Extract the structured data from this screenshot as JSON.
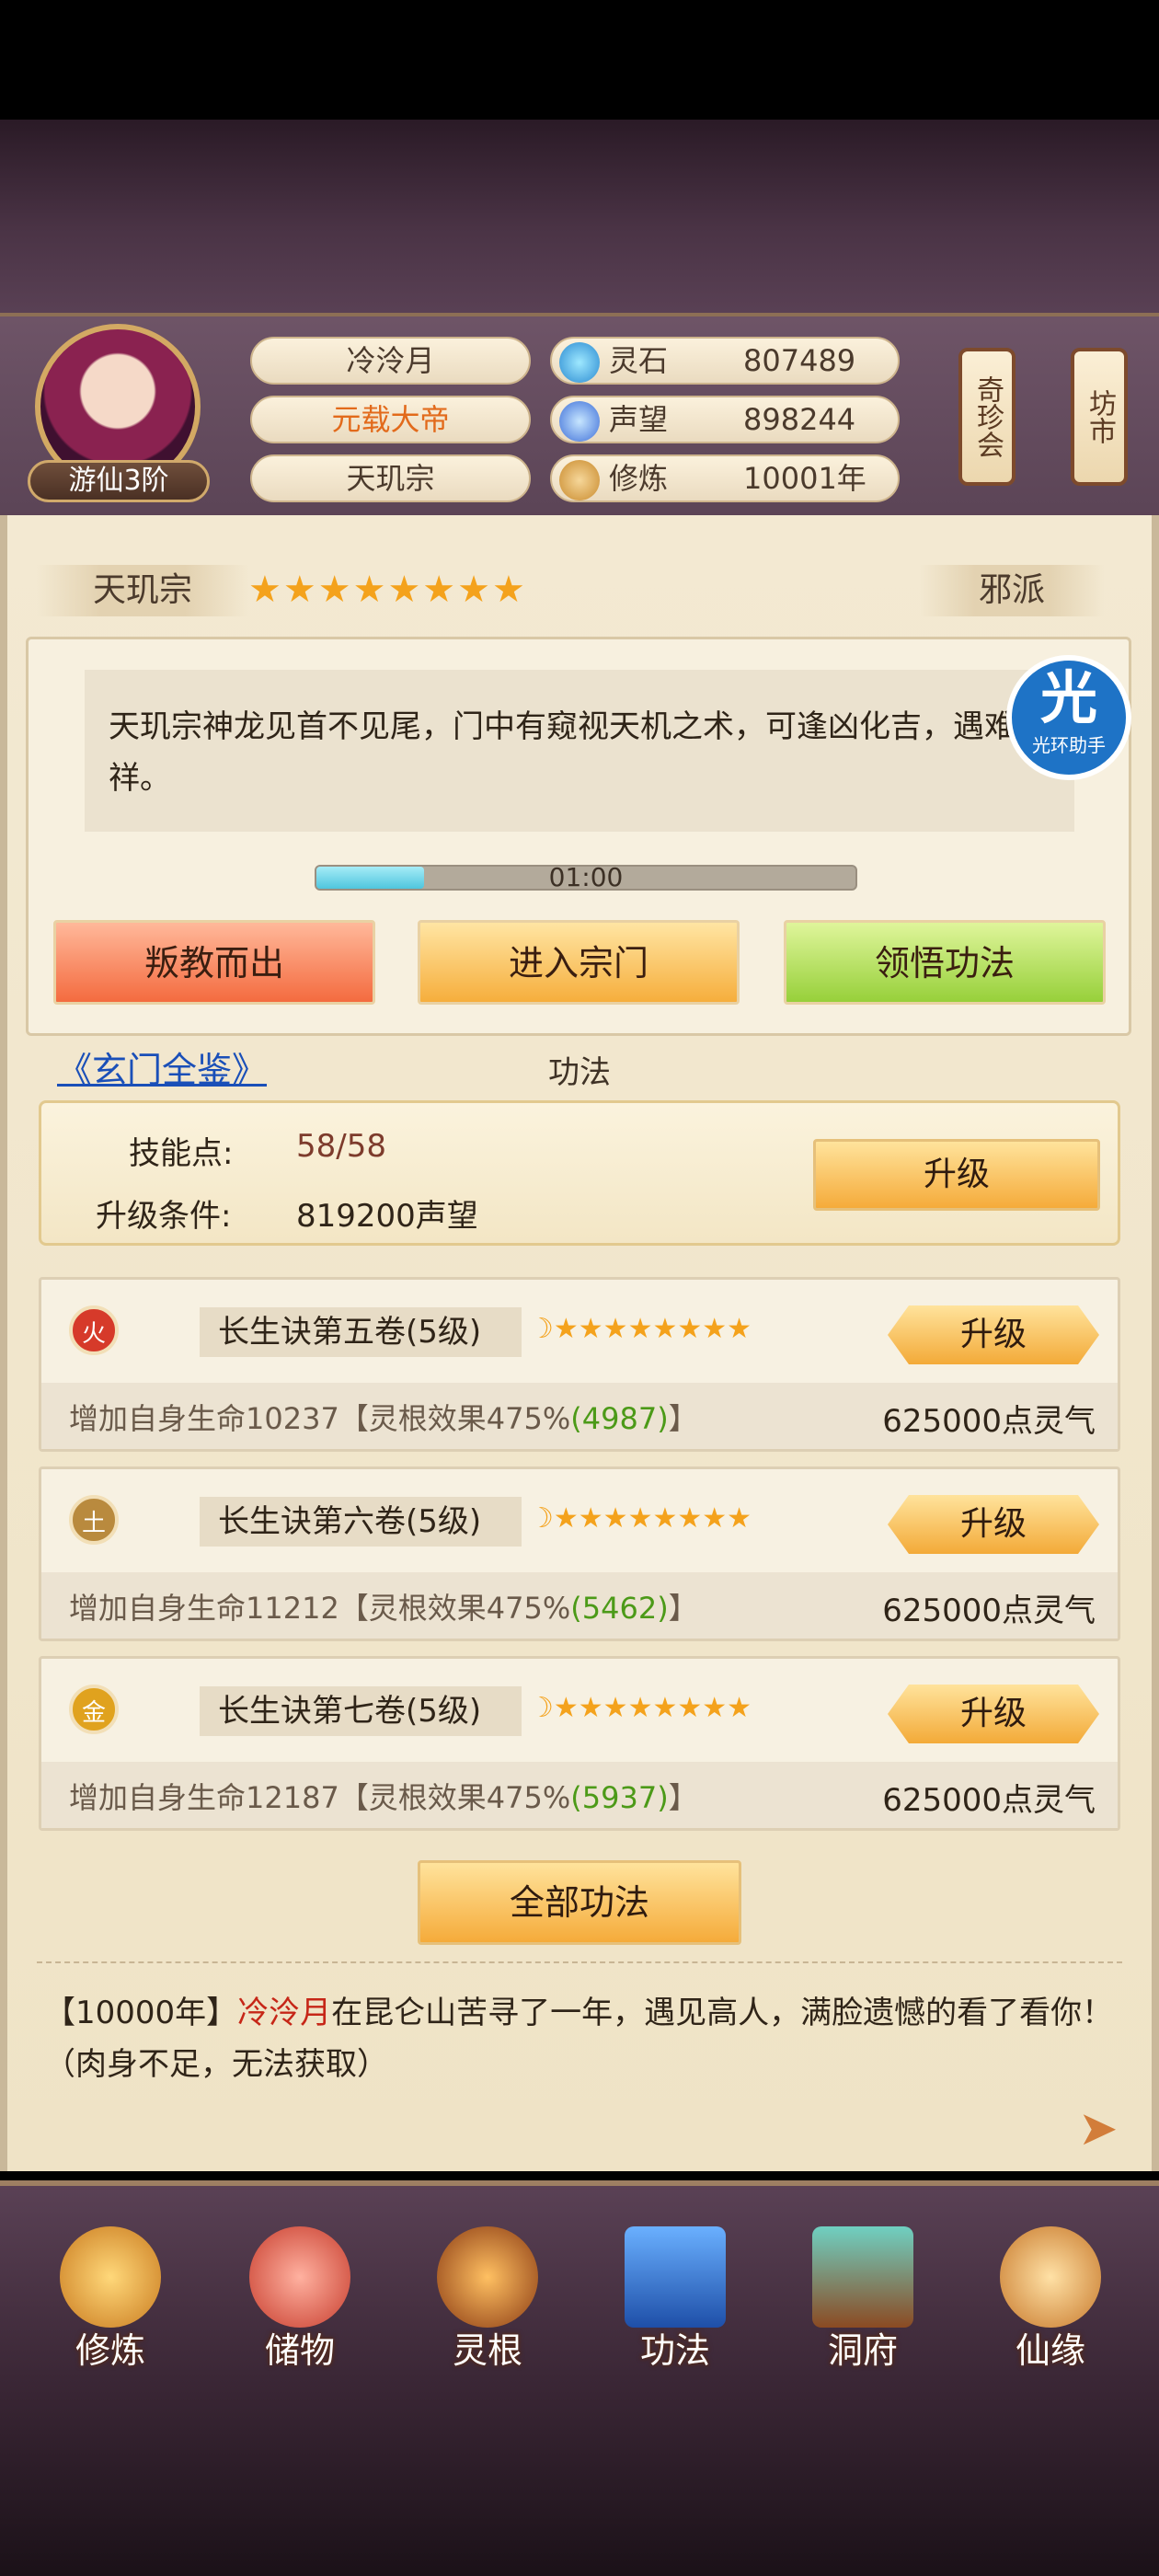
{
  "header": {
    "rank": "游仙3阶",
    "name": "冷泠月",
    "title": "元载大帝",
    "sect": "天玑宗",
    "resources": [
      {
        "label": "灵石",
        "value": "807489",
        "icon": "spirit-stone-icon"
      },
      {
        "label": "声望",
        "value": "898244",
        "icon": "prestige-icon"
      },
      {
        "label": "修炼",
        "value": "10001年",
        "icon": "meditation-icon"
      }
    ],
    "side_buttons": [
      "奇珍会",
      "坊市"
    ]
  },
  "sect_panel": {
    "name": "天玑宗",
    "stars": "★★★★★★★★",
    "faction": "邪派",
    "description": "天玑宗神龙见首不见尾，门中有窥视天机之术，可逢凶化吉，遇难呈祥。",
    "timer": "01:00",
    "timer_progress": 0.2,
    "buttons": [
      "叛教而出",
      "进入宗门",
      "领悟功法"
    ],
    "halo_badge": {
      "big": "光",
      "small": "光环助手"
    }
  },
  "gongfa": {
    "link": "《玄门全鉴》",
    "title": "功法",
    "skill_points_label": "技能点:",
    "skill_points_value": "58/58",
    "upgrade_cond_label": "升级条件:",
    "upgrade_cond_value": "819200声望",
    "upgrade_button": "升级",
    "techniques": [
      {
        "element": "火",
        "element_color": "#d63a2a",
        "name": "长生诀第五卷(5级)",
        "stars": "☽★★★★★★★★",
        "button": "升级",
        "effect_prefix": "增加自身生命10237【灵根效果475%",
        "effect_bonus": "(4987)",
        "effect_suffix": "】",
        "cost": "625000点灵气"
      },
      {
        "element": "土",
        "element_color": "#b98a3e",
        "name": "长生诀第六卷(5级)",
        "stars": "☽★★★★★★★★",
        "button": "升级",
        "effect_prefix": "增加自身生命11212【灵根效果475%",
        "effect_bonus": "(5462)",
        "effect_suffix": "】",
        "cost": "625000点灵气"
      },
      {
        "element": "金",
        "element_color": "#e0a21e",
        "name": "长生诀第七卷(5级)",
        "stars": "☽★★★★★★★★",
        "button": "升级",
        "effect_prefix": "增加自身生命12187【灵根效果475%",
        "effect_bonus": "(5937)",
        "effect_suffix": "】",
        "cost": "625000点灵气"
      }
    ],
    "all_button": "全部功法"
  },
  "log": {
    "year": "【10000年】",
    "name": "冷泠月",
    "text": "在昆仑山苦寻了一年，遇见高人，满脸遗憾的看了看你！（肉身不足，无法获取）"
  },
  "nav": [
    {
      "label": "修炼",
      "icon": "meditation-nav-icon"
    },
    {
      "label": "储物",
      "icon": "bag-nav-icon"
    },
    {
      "label": "灵根",
      "icon": "root-nav-icon"
    },
    {
      "label": "功法",
      "icon": "book-nav-icon"
    },
    {
      "label": "洞府",
      "icon": "cave-nav-icon"
    },
    {
      "label": "仙缘",
      "icon": "gourd-nav-icon"
    }
  ]
}
